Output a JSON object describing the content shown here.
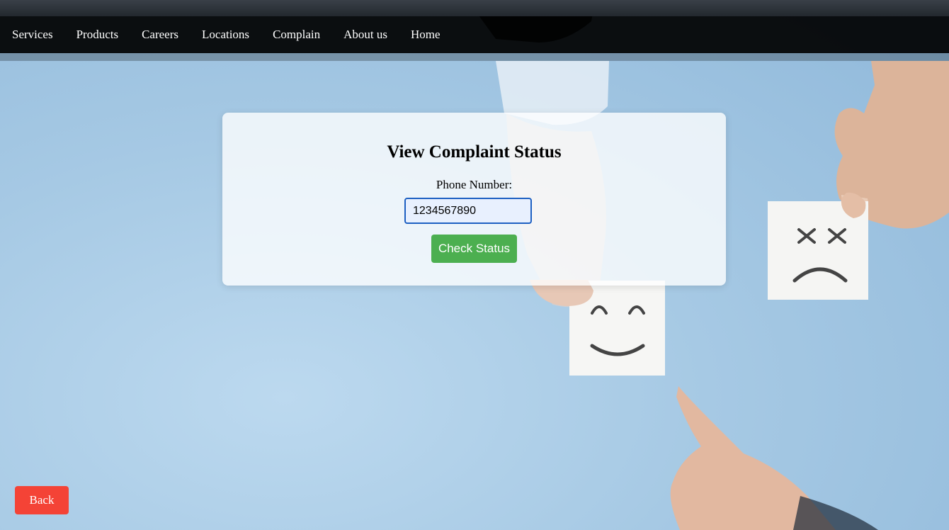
{
  "nav": {
    "items": [
      {
        "label": "Services"
      },
      {
        "label": "Products"
      },
      {
        "label": "Careers"
      },
      {
        "label": "Locations"
      },
      {
        "label": "Complain"
      },
      {
        "label": "About us"
      },
      {
        "label": "Home"
      }
    ]
  },
  "form": {
    "title": "View Complaint Status",
    "phone_label": "Phone Number:",
    "phone_value": "1234567890",
    "submit_label": "Check Status"
  },
  "back_label": "Back",
  "colors": {
    "nav_bg": "#000000",
    "submit_bg": "#4caf50",
    "back_bg": "#f44336",
    "input_border": "#1d5fc2"
  },
  "background_image": {
    "icons": [
      "smiley-face-note-icon",
      "dead-sad-face-note-icon",
      "hand-icon",
      "pointing-finger-icon"
    ]
  }
}
